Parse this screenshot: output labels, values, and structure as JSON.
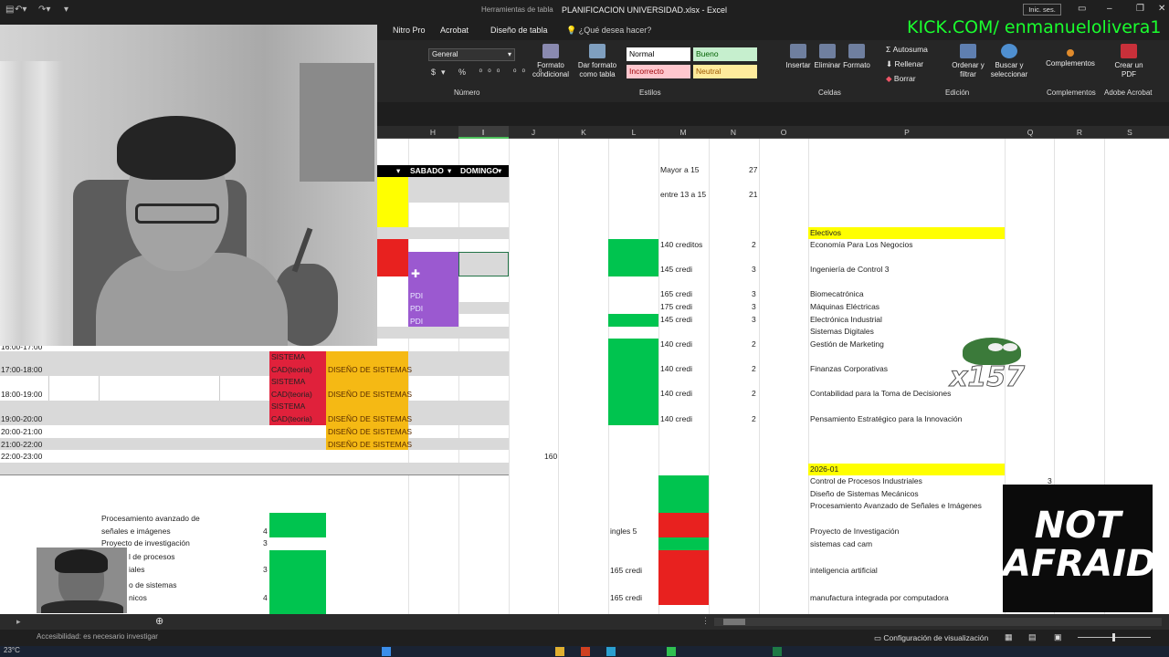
{
  "window": {
    "title": "PLANIFICACION UNIVERSIDAD.xlsx - Excel",
    "context_tab": "Herramientas de tabla",
    "login": "Inic. ses."
  },
  "tabs": [
    {
      "label": "Nitro Pro"
    },
    {
      "label": "Acrobat"
    },
    {
      "label": "Diseño de tabla"
    }
  ],
  "tell_me": "¿Qué desea hacer?",
  "overlay": {
    "kick": "KICK.COM/ enmanuelolivera1",
    "not_afraid_1": "NOT",
    "not_afraid_2": "AFRAID",
    "frog_text": "x157"
  },
  "ribbon": {
    "number_format": "General",
    "number_group": "Número",
    "conditional": "Formato condicional",
    "as_table": "Dar formato como tabla",
    "styles_group": "Estilos",
    "styles": [
      {
        "label": "Normal",
        "bg": "#ffffff",
        "fg": "#000000"
      },
      {
        "label": "Bueno",
        "bg": "#c6efce",
        "fg": "#006100"
      },
      {
        "label": "Incorrecto",
        "bg": "#ffc7ce",
        "fg": "#9c0006"
      },
      {
        "label": "Neutral",
        "bg": "#ffeb9c",
        "fg": "#9c5700"
      }
    ],
    "insert": "Insertar",
    "delete": "Eliminar",
    "format": "Formato",
    "cells_group": "Celdas",
    "autosum": "Autosuma",
    "fill": "Rellenar",
    "clear": "Borrar",
    "sort": "Ordenar y filtrar",
    "find": "Buscar y seleccionar",
    "edit_group": "Edición",
    "addins": "Complementos",
    "addins_group": "Complementos",
    "create_pdf": "Crear un PDF",
    "adobe_group": "Adobe Acrobat"
  },
  "columns": [
    "H",
    "I",
    "J",
    "K",
    "L",
    "M",
    "N",
    "O",
    "P",
    "Q",
    "R",
    "S"
  ],
  "table_headers": {
    "sabado": "SABADO",
    "domingo": "DOMINGO"
  },
  "pdi": [
    "PDI",
    "PDI",
    "PDI"
  ],
  "schedule": {
    "t1": "16:00-17:00",
    "t2": "17:00-18:00",
    "t3": "18:00-19:00",
    "t4": "19:00-20:00",
    "t5": "20:00-21:00",
    "t6": "21:00-22:00",
    "t7": "22:00-23:00",
    "cad_a": "SISTEMA",
    "cad_b": "CAD(teoria)",
    "diseno": "DISEÑO DE SISTEMAS",
    "j_total": "160"
  },
  "stats": {
    "mayor_label": "Mayor a 15",
    "mayor_val": "27",
    "entre_label": "entre 13 a 15",
    "entre_val": "21"
  },
  "credits": [
    {
      "label": "140 creditos",
      "n": "2"
    },
    {
      "label": "145 credi",
      "n": "3"
    },
    {
      "label": "165 credi",
      "n": "3"
    },
    {
      "label": "175 credi",
      "n": "3"
    },
    {
      "label": "145 credi",
      "n": "3"
    },
    {
      "label": "140 credi",
      "n": "2"
    },
    {
      "label": "140 credi",
      "n": "2"
    },
    {
      "label": "140 credi",
      "n": "2"
    },
    {
      "label": "140 credi",
      "n": "2"
    }
  ],
  "electivos": {
    "header": "Electivos",
    "items": [
      "Economía Para Los Negocios",
      "Ingeniería de Control 3",
      "Biomecatrónica",
      "Máquinas Eléctricas",
      "Electrónica Industrial",
      "Sistemas Digitales",
      "Gestión de Marketing",
      "Finanzas Corporativas",
      "Contabilidad para la Toma de Decisiones",
      "Pensamiento Estratégico para la Innovación"
    ]
  },
  "term": {
    "header": "2026-01",
    "items": [
      "Control de Procesos Industriales",
      "Diseño de Sistemas Mecánicos",
      "Procesamiento Avanzado de Señales e Imágenes",
      "Proyecto de Investigación",
      "sistemas cad cam",
      "inteligencia artificial",
      "manufactura integrada por computadora"
    ],
    "q_val": "3"
  },
  "lower_left": {
    "proc_a": "Procesamiento avanzado de",
    "proc_b": "señales e imágenes",
    "proc_n": "4",
    "proy": "Proyecto de investigación",
    "proy_n": "3",
    "ctrl_a": "l de procesos",
    "ctrl_b": "iales",
    "ctrl_n": "3",
    "dis_a": "o de sistemas",
    "dis_b": "nicos",
    "dis_n": "4"
  },
  "lower_mid": {
    "ingles": "ingles 5",
    "c1": "165 credi",
    "c2": "165 credi"
  },
  "statusbar": {
    "view_config": "Configuración de visualización",
    "accessibility": "Accesibilidad: es necesario investigar",
    "temp": "23°C"
  },
  "colors": {
    "green": "#00c44f",
    "red": "#e8211f",
    "yellow": "#ffff00",
    "purple": "#9b59d0",
    "orange": "#f5b914",
    "cadred": "#e0213b"
  }
}
